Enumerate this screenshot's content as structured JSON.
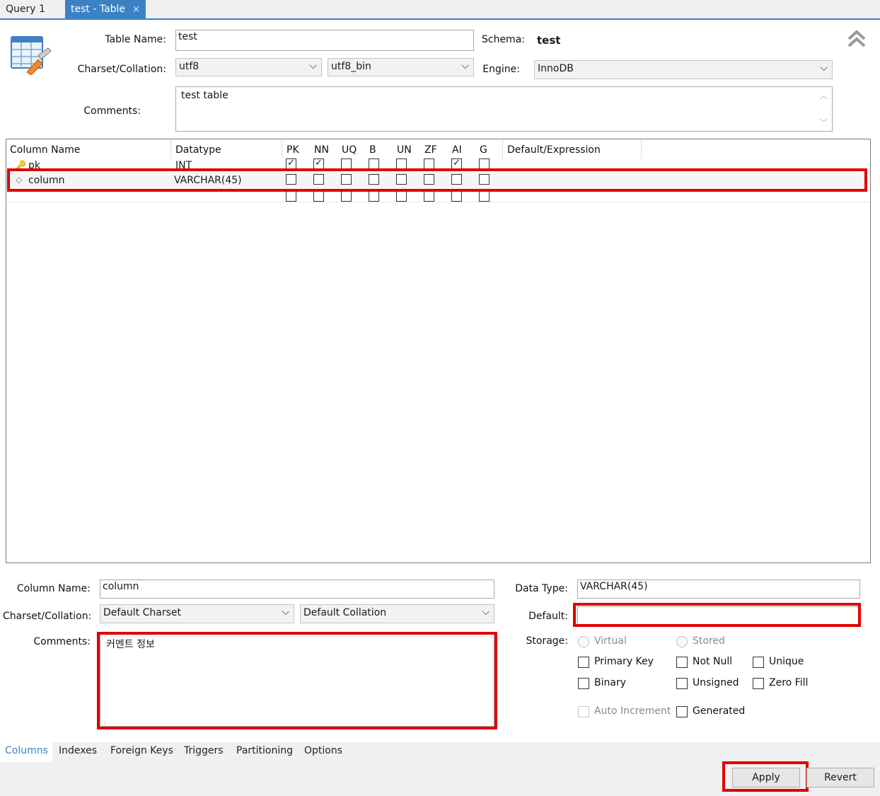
{
  "tabs": [
    {
      "label": "Query 1"
    },
    {
      "label": "test - Table",
      "close": "×"
    }
  ],
  "header": {
    "table_name_label": "Table Name:",
    "table_name": "test",
    "schema_label": "Schema:",
    "schema": "test",
    "charset_label": "Charset/Collation:",
    "charset": "utf8",
    "collation": "utf8_bin",
    "engine_label": "Engine:",
    "engine": "InnoDB",
    "comments_label": "Comments:",
    "comments": "test table"
  },
  "columns_grid": {
    "headers": [
      "Column Name",
      "Datatype",
      "PK",
      "NN",
      "UQ",
      "B",
      "UN",
      "ZF",
      "AI",
      "G",
      "Default/Expression"
    ],
    "rows": [
      {
        "name": "pk",
        "type": "INT",
        "flags": [
          true,
          true,
          false,
          false,
          false,
          false,
          true,
          false
        ],
        "default": ""
      },
      {
        "name": "column",
        "type": "VARCHAR(45)",
        "flags": [
          false,
          false,
          false,
          false,
          false,
          false,
          false,
          false
        ],
        "default": ""
      }
    ]
  },
  "detail": {
    "column_name_label": "Column Name:",
    "column_name": "column",
    "charset_label": "Charset/Collation:",
    "charset": "Default Charset",
    "collation": "Default Collation",
    "comments_label": "Comments:",
    "comments": "커멘트 정보",
    "data_type_label": "Data Type:",
    "data_type": "VARCHAR(45)",
    "default_label": "Default:",
    "default_value": "",
    "storage_label": "Storage:",
    "storage_options": [
      "Virtual",
      "Stored"
    ],
    "checkboxes": {
      "primary_key": "Primary Key",
      "not_null": "Not Null",
      "unique": "Unique",
      "binary": "Binary",
      "unsigned": "Unsigned",
      "zero_fill": "Zero Fill",
      "auto_increment": "Auto Increment",
      "generated": "Generated"
    }
  },
  "bottom_tabs": [
    "Columns",
    "Indexes",
    "Foreign Keys",
    "Triggers",
    "Partitioning",
    "Options"
  ],
  "footer": {
    "apply": "Apply",
    "revert": "Revert"
  },
  "colors": {
    "accent": "#3b82c4",
    "highlight": "#e00000"
  }
}
